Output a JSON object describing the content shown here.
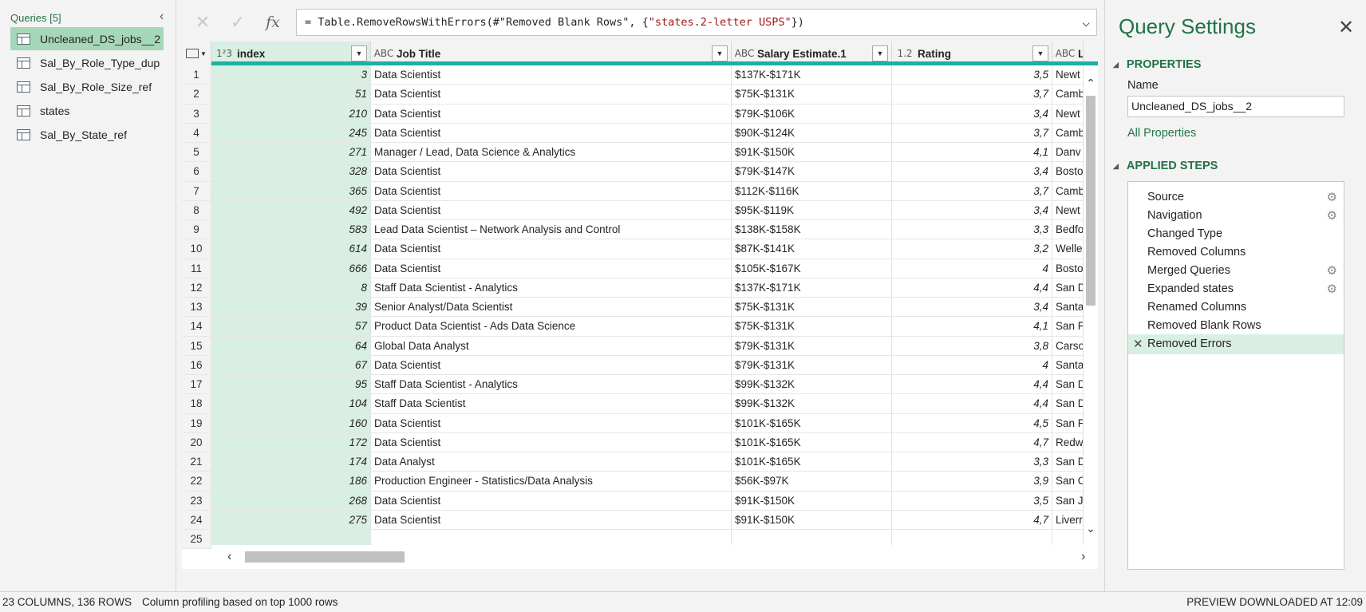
{
  "queries": {
    "header": "Queries [5]",
    "items": [
      {
        "label": "Uncleaned_DS_jobs__2",
        "selected": true
      },
      {
        "label": "Sal_By_Role_Type_dup",
        "selected": false
      },
      {
        "label": "Sal_By_Role_Size_ref",
        "selected": false
      },
      {
        "label": "states",
        "selected": false
      },
      {
        "label": "Sal_By_State_ref",
        "selected": false
      }
    ]
  },
  "formula_bar": {
    "cancel": "✕",
    "confirm": "✓",
    "fx": "fx",
    "formula_prefix": "= Table.RemoveRowsWithErrors(#\"Removed Blank Rows\", {",
    "formula_string": "\"states.2-letter USPS\"",
    "formula_suffix": "})"
  },
  "grid": {
    "columns": [
      {
        "type": "1²3",
        "name": "index"
      },
      {
        "type": "ABC",
        "name": "Job Title"
      },
      {
        "type": "ABC",
        "name": "Salary Estimate.1"
      },
      {
        "type": "1.2",
        "name": "Rating"
      },
      {
        "type": "ABC",
        "name": "Loca"
      }
    ],
    "rows": [
      {
        "n": "1",
        "index": "3",
        "job": "Data Scientist",
        "salary": "$137K-$171K",
        "rating": "3,5",
        "loc": "Newt"
      },
      {
        "n": "2",
        "index": "51",
        "job": "Data Scientist",
        "salary": "$75K-$131K",
        "rating": "3,7",
        "loc": "Camb"
      },
      {
        "n": "3",
        "index": "210",
        "job": "Data Scientist",
        "salary": "$79K-$106K",
        "rating": "3,4",
        "loc": "Newt"
      },
      {
        "n": "4",
        "index": "245",
        "job": "Data Scientist",
        "salary": "$90K-$124K",
        "rating": "3,7",
        "loc": "Camb"
      },
      {
        "n": "5",
        "index": "271",
        "job": "Manager / Lead, Data Science & Analytics",
        "salary": "$91K-$150K",
        "rating": "4,1",
        "loc": "Danv"
      },
      {
        "n": "6",
        "index": "328",
        "job": "Data Scientist",
        "salary": "$79K-$147K",
        "rating": "3,4",
        "loc": "Bosto"
      },
      {
        "n": "7",
        "index": "365",
        "job": "Data Scientist",
        "salary": "$112K-$116K",
        "rating": "3,7",
        "loc": "Camb"
      },
      {
        "n": "8",
        "index": "492",
        "job": "Data Scientist",
        "salary": "$95K-$119K",
        "rating": "3,4",
        "loc": "Newt"
      },
      {
        "n": "9",
        "index": "583",
        "job": "Lead Data Scientist – Network Analysis and Control",
        "salary": "$138K-$158K",
        "rating": "3,3",
        "loc": "Bedfo"
      },
      {
        "n": "10",
        "index": "614",
        "job": "Data Scientist",
        "salary": "$87K-$141K",
        "rating": "3,2",
        "loc": "Welle"
      },
      {
        "n": "11",
        "index": "666",
        "job": "Data Scientist",
        "salary": "$105K-$167K",
        "rating": "4",
        "loc": "Bosto"
      },
      {
        "n": "12",
        "index": "8",
        "job": "Staff Data Scientist - Analytics",
        "salary": "$137K-$171K",
        "rating": "4,4",
        "loc": "San D"
      },
      {
        "n": "13",
        "index": "39",
        "job": "Senior Analyst/Data Scientist",
        "salary": "$75K-$131K",
        "rating": "3,4",
        "loc": "Santa"
      },
      {
        "n": "14",
        "index": "57",
        "job": "Product Data Scientist - Ads Data Science",
        "salary": "$75K-$131K",
        "rating": "4,1",
        "loc": "San F"
      },
      {
        "n": "15",
        "index": "64",
        "job": "Global Data Analyst",
        "salary": "$79K-$131K",
        "rating": "3,8",
        "loc": "Carso"
      },
      {
        "n": "16",
        "index": "67",
        "job": "Data Scientist",
        "salary": "$79K-$131K",
        "rating": "4",
        "loc": "Santa"
      },
      {
        "n": "17",
        "index": "95",
        "job": "Staff Data Scientist - Analytics",
        "salary": "$99K-$132K",
        "rating": "4,4",
        "loc": "San D"
      },
      {
        "n": "18",
        "index": "104",
        "job": "Staff Data Scientist",
        "salary": "$99K-$132K",
        "rating": "4,4",
        "loc": "San D"
      },
      {
        "n": "19",
        "index": "160",
        "job": "Data Scientist",
        "salary": "$101K-$165K",
        "rating": "4,5",
        "loc": "San F"
      },
      {
        "n": "20",
        "index": "172",
        "job": "Data Scientist",
        "salary": "$101K-$165K",
        "rating": "4,7",
        "loc": "Redw"
      },
      {
        "n": "21",
        "index": "174",
        "job": "Data Analyst",
        "salary": "$101K-$165K",
        "rating": "3,3",
        "loc": "San D"
      },
      {
        "n": "22",
        "index": "186",
        "job": "Production Engineer - Statistics/Data Analysis",
        "salary": "$56K-$97K",
        "rating": "3,9",
        "loc": "San C"
      },
      {
        "n": "23",
        "index": "268",
        "job": "Data Scientist",
        "salary": "$91K-$150K",
        "rating": "3,5",
        "loc": "San Jo"
      },
      {
        "n": "24",
        "index": "275",
        "job": "Data Scientist",
        "salary": "$91K-$150K",
        "rating": "4,7",
        "loc": "Liverr"
      },
      {
        "n": "25",
        "index": "",
        "job": "",
        "salary": "",
        "rating": "",
        "loc": ""
      }
    ]
  },
  "settings": {
    "title": "Query Settings",
    "properties_label": "PROPERTIES",
    "name_label": "Name",
    "name_value": "Uncleaned_DS_jobs__2",
    "all_properties": "All Properties",
    "applied_steps_label": "APPLIED STEPS",
    "steps": [
      {
        "label": "Source",
        "gear": true,
        "selected": false
      },
      {
        "label": "Navigation",
        "gear": true,
        "selected": false
      },
      {
        "label": "Changed Type",
        "gear": false,
        "selected": false
      },
      {
        "label": "Removed Columns",
        "gear": false,
        "selected": false
      },
      {
        "label": "Merged Queries",
        "gear": true,
        "selected": false
      },
      {
        "label": "Expanded states",
        "gear": true,
        "selected": false
      },
      {
        "label": "Renamed Columns",
        "gear": false,
        "selected": false
      },
      {
        "label": "Removed Blank Rows",
        "gear": false,
        "selected": false
      },
      {
        "label": "Removed Errors",
        "gear": false,
        "selected": true
      }
    ]
  },
  "status": {
    "columns_rows": "23 COLUMNS, 136 ROWS",
    "profiling": "Column profiling based on top 1000 rows",
    "preview": "PREVIEW DOWNLOADED AT 12:09"
  }
}
